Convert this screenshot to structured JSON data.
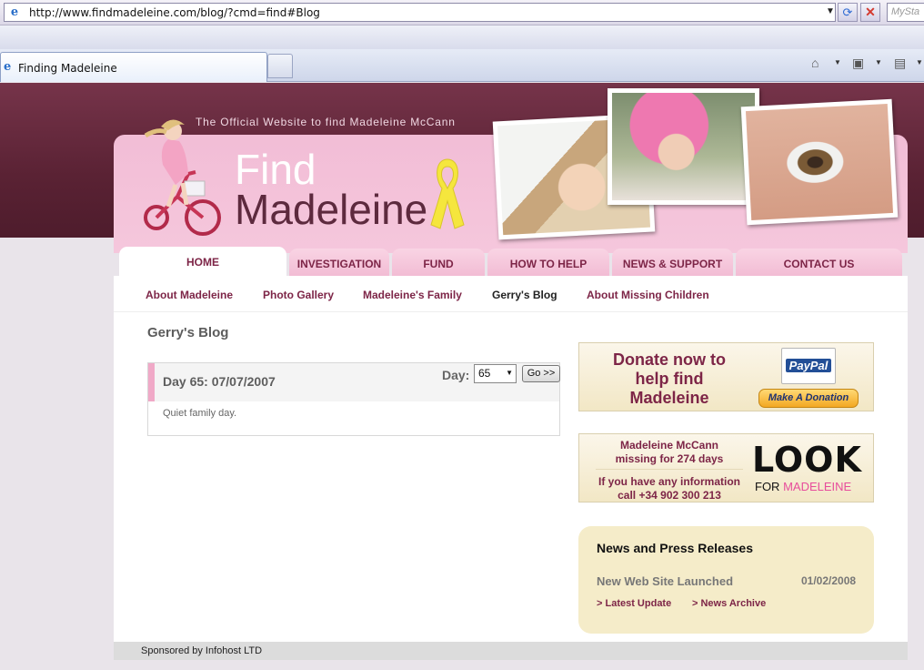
{
  "browser": {
    "address_url": "http://www.findmadeleine.com/blog/?cmd=find#Blog",
    "search_placeholder": "MySta",
    "tab_title": "Finding Madeleine"
  },
  "header": {
    "tagline": "The Official Website to find Madeleine McCann",
    "logo_line1": "Find",
    "logo_line2": "Madeleine"
  },
  "nav": {
    "tabs": [
      {
        "label": "HOME",
        "active": true
      },
      {
        "label": "INVESTIGATION",
        "active": false
      },
      {
        "label": "FUND",
        "active": false
      },
      {
        "label": "HOW TO HELP",
        "active": false
      },
      {
        "label": "NEWS & SUPPORT",
        "active": false
      },
      {
        "label": "CONTACT US",
        "active": false
      }
    ],
    "sub_items": [
      {
        "label": "About Madeleine"
      },
      {
        "label": "Photo Gallery"
      },
      {
        "label": "Madeleine's Family"
      },
      {
        "label": "Gerry's Blog",
        "current": true
      },
      {
        "label": "About Missing Children"
      }
    ]
  },
  "main": {
    "page_title": "Gerry's Blog",
    "blog": {
      "entry_title": "Day 65: 07/07/2007",
      "day_label": "Day:",
      "day_value": "65",
      "go_label": "Go >>",
      "text": "Quiet family day."
    }
  },
  "sidebar": {
    "donate": {
      "line1": "Donate now to",
      "line2": "help find",
      "line3": "Madeleine",
      "paypal_label": "PayPal",
      "button_label": "Make A Donation"
    },
    "look": {
      "missing_line1": "Madeleine McCann",
      "missing_line2": "missing for 274 days",
      "info_line1": "If you have any information",
      "info_line2": "call +34 902 300 213",
      "logo": "LOOK",
      "sub_for": "FOR",
      "sub_name": "MADELEINE"
    },
    "news": {
      "title": "News and Press Releases",
      "item": "New Web Site Launched",
      "date": "01/02/2008",
      "latest_link": "> Latest Update",
      "archive_link": "> News Archive"
    }
  },
  "footer": {
    "sponsor": "Sponsored by Infohost LTD"
  },
  "colors": {
    "brand_maroon": "#7d2547",
    "header_pink": "#f2bdd6",
    "top_band": "#5a2234",
    "sidebar_cream": "#f5ecc9"
  }
}
